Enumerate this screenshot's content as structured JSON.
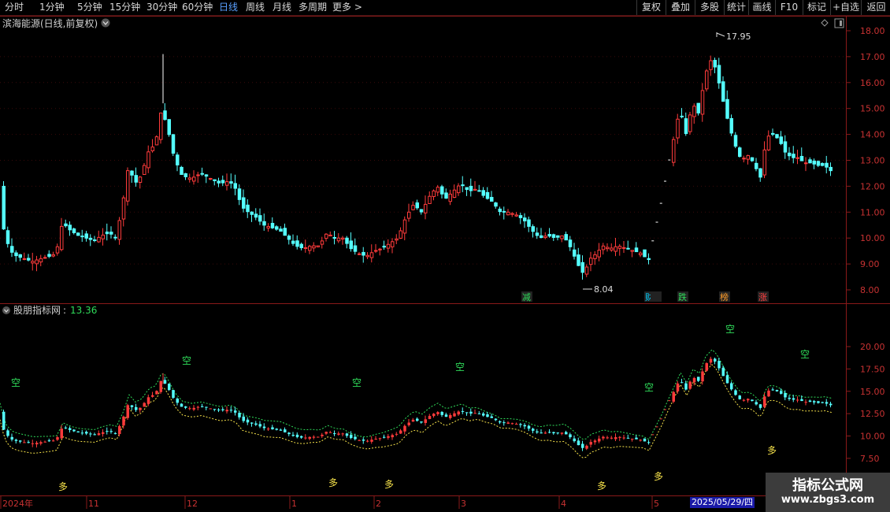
{
  "toolbar": {
    "timeframes": [
      "分时",
      "1分钟",
      "5分钟",
      "15分钟",
      "30分钟",
      "60分钟",
      "日线",
      "周线",
      "月线",
      "多周期",
      "更多 >"
    ],
    "active_timeframe": "日线",
    "buttons": [
      "复权",
      "叠加",
      "多股",
      "统计",
      "画线",
      "F10",
      "标记",
      "+自选",
      "返回"
    ]
  },
  "main_panel": {
    "title": "滨海能源(日线,前复权)",
    "high_label": "17.95",
    "low_label": "8.04",
    "price_axis": [
      "18.00",
      "17.00",
      "16.00",
      "15.00",
      "14.00",
      "13.00",
      "12.00",
      "11.00",
      "10.00",
      "9.00",
      "8.00"
    ],
    "event_badges": [
      {
        "text": "减",
        "color": "#2fdc5a"
      },
      {
        "text": "财",
        "color": "#00d0ff"
      },
      {
        "text": "跌",
        "color": "#2fdc5a"
      },
      {
        "text": "榜",
        "color": "#ff9c2a"
      },
      {
        "text": "涨",
        "color": "#ff4040"
      }
    ]
  },
  "indicator_panel": {
    "name": "股朋指标网",
    "value": "13.36",
    "axis": [
      "20.00",
      "17.50",
      "15.00",
      "12.50",
      "10.00",
      "7.50"
    ],
    "kong_label": "空",
    "duo_label": "多"
  },
  "time_axis": {
    "labels": [
      "2024年",
      "11",
      "12",
      "1",
      "2",
      "3",
      "4",
      "5"
    ],
    "cursor_date": "2025/05/29/四"
  },
  "watermark": {
    "line1": "指标公式网",
    "line2": "www.zbgs3.com"
  },
  "colors": {
    "up": "#ff3b3b",
    "down": "#54ffff",
    "frame": "#8a1a1a",
    "green_text": "#2fdc5a",
    "yellow_text": "#f5e14a"
  }
}
